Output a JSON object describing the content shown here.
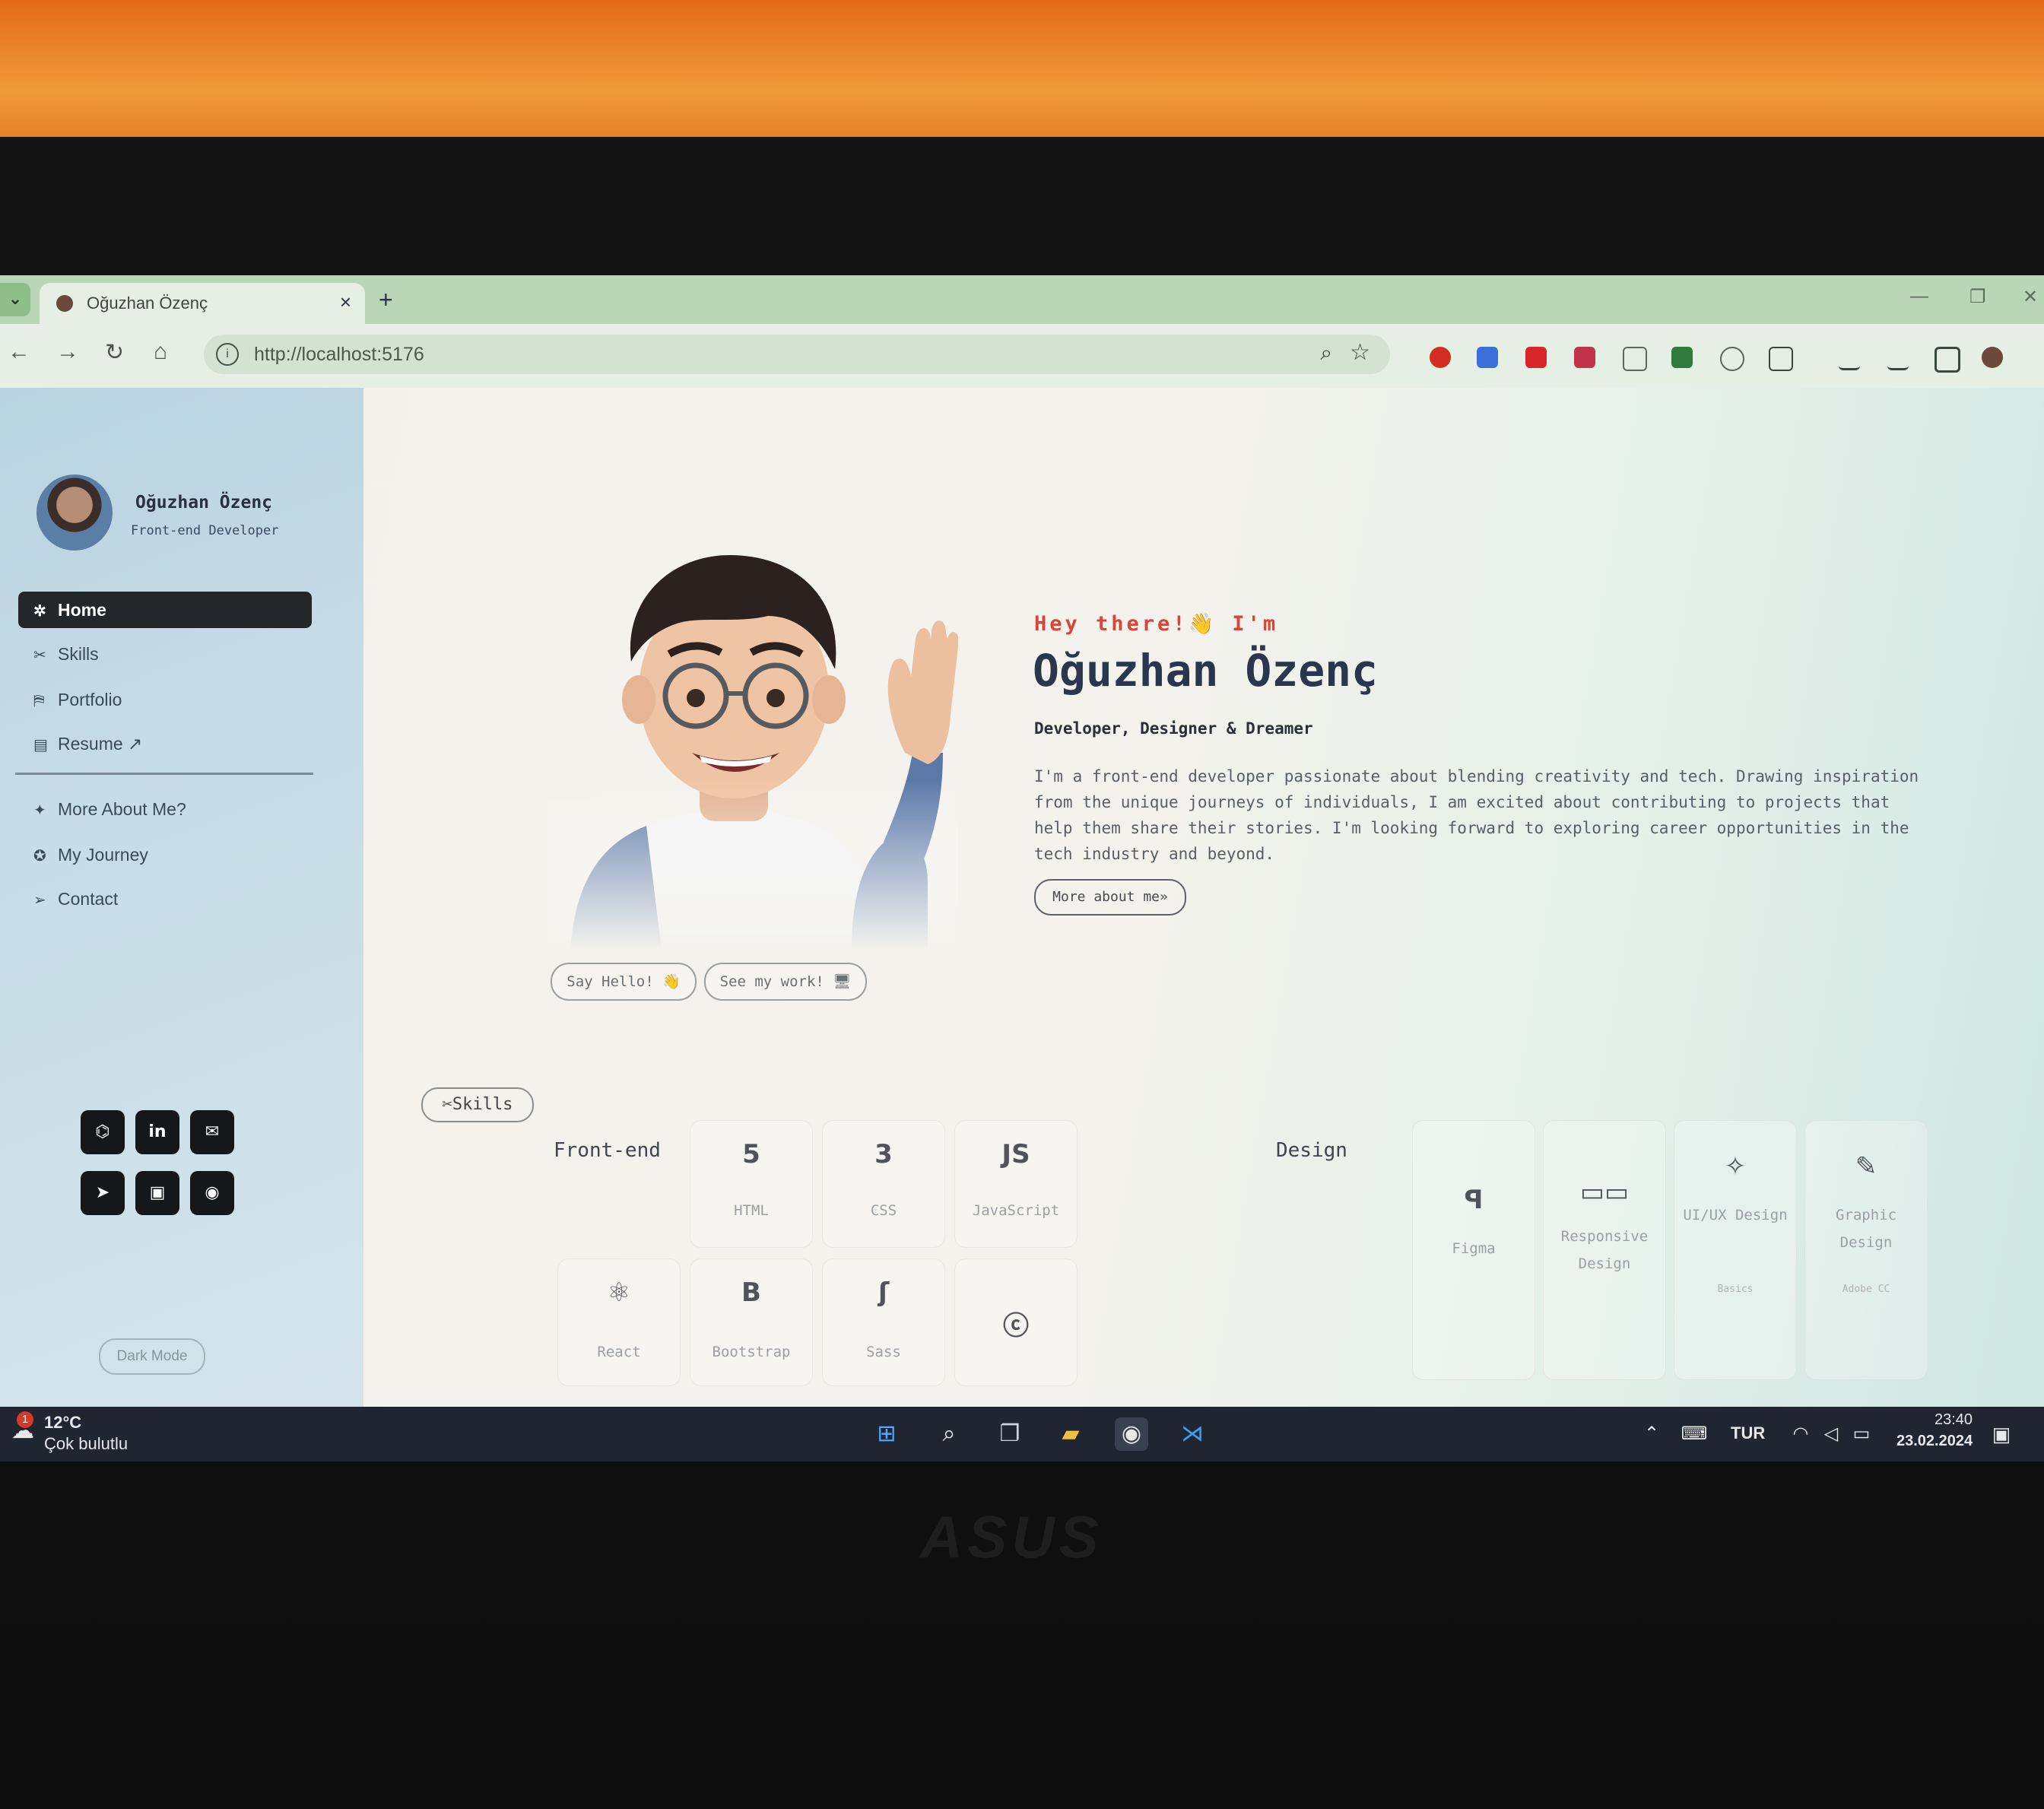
{
  "browser": {
    "tab_title": "Oğuzhan Özenç",
    "tab_close": "×",
    "new_tab": "+",
    "url": "http://localhost:5176"
  },
  "sidebar": {
    "name": "Oğuzhan Özenç",
    "role": "Front-end Developer",
    "nav": [
      {
        "label": "Home",
        "icon": "sparkle-icon",
        "glyph": "✲"
      },
      {
        "label": "Skills",
        "icon": "tools-icon",
        "glyph": "✂"
      },
      {
        "label": "Portfolio",
        "icon": "presentation-icon",
        "glyph": "⛿"
      },
      {
        "label": "Resume ↗",
        "icon": "document-icon",
        "glyph": "▤"
      }
    ],
    "nav2": [
      {
        "label": "More About Me?",
        "icon": "person-icon",
        "glyph": "✦"
      },
      {
        "label": "My Journey",
        "icon": "compass-icon",
        "glyph": "✪"
      },
      {
        "label": "Contact",
        "icon": "send-icon",
        "glyph": "➢"
      }
    ],
    "dark_mode": "Dark Mode"
  },
  "hero": {
    "greeting": "Hey there!👋 I'm",
    "name": "Oğuzhan Özenç",
    "tagline": "Developer, Designer & Dreamer",
    "about": "I'm a front-end developer passionate about blending creativity and tech. Drawing inspiration from the unique journeys of individuals, I am excited about contributing to projects that help them share their stories. I'm looking forward to exploring career opportunities in the tech industry and beyond.",
    "more_button": "More about me»",
    "say_hello": "Say Hello! 👋",
    "see_work": "See my work! 🖥"
  },
  "skills": {
    "badge": "✂Skills",
    "frontend_title": "Front-end",
    "design_title": "Design",
    "frontend": [
      {
        "label": "HTML",
        "glyph": "5"
      },
      {
        "label": "CSS",
        "glyph": "3"
      },
      {
        "label": "JavaScript",
        "glyph": "JS"
      },
      {
        "label": "React",
        "glyph": "⚛"
      },
      {
        "label": "Bootstrap",
        "glyph": "B"
      },
      {
        "label": "Sass",
        "glyph": "ʃ"
      },
      {
        "label": "",
        "glyph": "ⓒ"
      }
    ],
    "design": [
      {
        "label": "Figma",
        "glyph": "ꟼ",
        "sub": ""
      },
      {
        "label": "Responsive Design",
        "glyph": "▭▭",
        "sub": ""
      },
      {
        "label": "UI/UX Design",
        "glyph": "✧",
        "sub": "Basics"
      },
      {
        "label": "Graphic Design",
        "glyph": "✎",
        "sub": "Adobe CC"
      }
    ]
  },
  "taskbar": {
    "temp": "12°C",
    "weather": "Çok bulutlu",
    "weather_badge": "1",
    "lang": "TUR",
    "time": "23:40",
    "date": "23.02.2024"
  },
  "laptop_logo": "ASUS"
}
